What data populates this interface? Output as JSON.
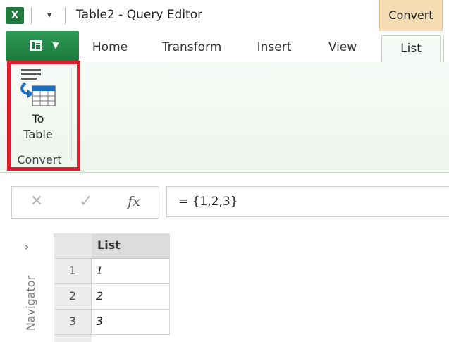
{
  "window": {
    "title": "Table2 - Query Editor",
    "app_icon": "excel-icon",
    "qat_icon": "customize-qat-icon"
  },
  "contextual_tab_group": {
    "label": "Convert",
    "color": "#f6ddb4"
  },
  "tabs": [
    {
      "label": "Home"
    },
    {
      "label": "Transform"
    },
    {
      "label": "Insert"
    },
    {
      "label": "View"
    },
    {
      "label": "List",
      "active": true
    }
  ],
  "file_button": {
    "icon": "file-menu-icon"
  },
  "ribbon": {
    "groups": [
      {
        "label": "Convert",
        "buttons": [
          {
            "label_line1": "To",
            "label_line2": "Table",
            "icon": "to-table-icon"
          }
        ]
      }
    ],
    "highlight_color": "#e21b2d"
  },
  "formula_bar": {
    "cancel_icon": "cancel-icon",
    "enter_icon": "checkmark-icon",
    "fx_label": "fx",
    "formula": "= {1,2,3}"
  },
  "navigator": {
    "label": "Navigator",
    "chevron": "›"
  },
  "grid": {
    "column_header": "List",
    "rows": [
      {
        "index": "1",
        "value": "1"
      },
      {
        "index": "2",
        "value": "2"
      },
      {
        "index": "3",
        "value": "3"
      }
    ]
  },
  "colors": {
    "excel_green": "#1f7a3d",
    "ribbon_bg": "#f7fbf7",
    "header_bg": "#dcdcdc"
  }
}
